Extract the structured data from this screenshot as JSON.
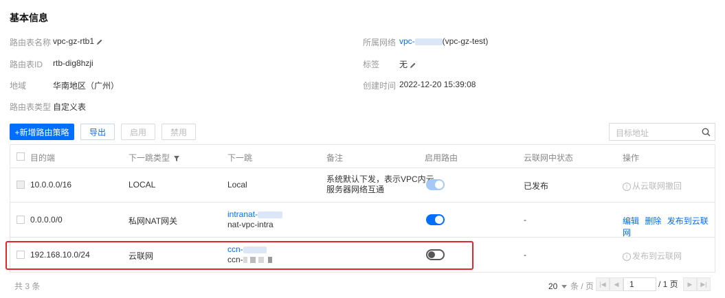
{
  "section_title": "基本信息",
  "info": {
    "name_label": "路由表名称",
    "name_value": "vpc-gz-rtb1",
    "id_label": "路由表ID",
    "id_value": "rtb-dig8hzji",
    "region_label": "地域",
    "region_value": "华南地区（广州）",
    "type_label": "路由表类型",
    "type_value": "自定义表",
    "network_label": "所属网络",
    "network_prefix": "vpc-",
    "network_suffix": "(vpc-gz-test)",
    "tag_label": "标签",
    "tag_value": "无",
    "created_label": "创建时间",
    "created_value": "2022-12-20 15:39:08"
  },
  "toolbar": {
    "add_label": "+新增路由策略",
    "export_label": "导出",
    "enable_label": "启用",
    "disable_label": "禁用",
    "search_placeholder": "目标地址"
  },
  "table": {
    "headers": {
      "dest": "目的端",
      "hop_type": "下一跳类型",
      "hop": "下一跳",
      "note": "备注",
      "enable": "启用路由",
      "ccn_status": "云联网中状态",
      "ops": "操作"
    },
    "rows": [
      {
        "dest": "10.0.0.0/16",
        "hop_type": "LOCAL",
        "hop": "Local",
        "note_line1": "系统默认下发，表示VPC内云",
        "note_line2": "服务器网络互通",
        "enabled": true,
        "ccn_status": "已发布",
        "op": "从云联网撤回"
      },
      {
        "dest": "0.0.0.0/0",
        "hop_type": "私网NAT网关",
        "hop_line1": "intranat-",
        "hop_line2": "nat-vpc-intra",
        "enabled": true,
        "ccn_status": "-",
        "op_edit": "编辑",
        "op_delete": "删除",
        "op_publish": "发布到云联网"
      },
      {
        "dest": "192.168.10.0/24",
        "hop_type": "云联网",
        "hop_line1": "ccn-",
        "hop_line2": "ccn-",
        "enabled": false,
        "ccn_status": "-",
        "op": "发布到云联网"
      }
    ]
  },
  "footer": {
    "total": "共 3 条",
    "page_size": "20",
    "per_page": "条 / 页",
    "current_page": "1",
    "total_pages": "/ 1 页"
  },
  "colors": {
    "primary": "#006eff",
    "highlight": "#e0262f"
  }
}
